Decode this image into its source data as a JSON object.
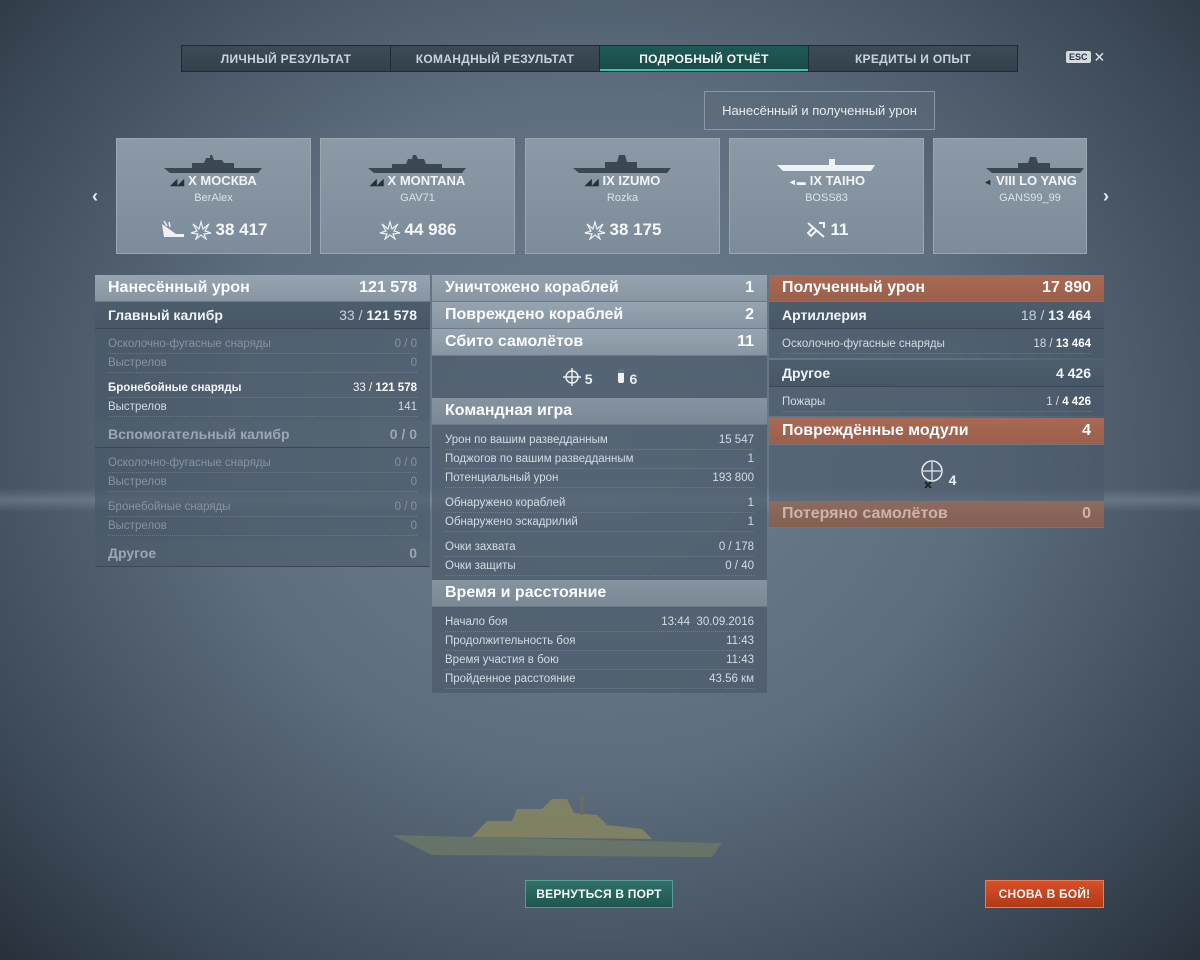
{
  "tabs": [
    {
      "label": "ЛИЧНЫЙ РЕЗУЛЬТАТ",
      "active": false
    },
    {
      "label": "КОМАНДНЫЙ РЕЗУЛЬТАТ",
      "active": false
    },
    {
      "label": "ПОДРОБНЫЙ ОТЧЁТ",
      "active": true
    },
    {
      "label": "КРЕДИТЫ И ОПЫТ",
      "active": false
    }
  ],
  "esc_label": "ESC",
  "damage_select": "Нанесённый и полученный урон",
  "ships": [
    {
      "tier_name": "X МОСКВА",
      "player": "BerAlex",
      "stat": "38 417",
      "icon": "torpedo-hit-icon"
    },
    {
      "tier_name": "X MONTANA",
      "player": "GAV71",
      "stat": "44 986",
      "icon": "damage-icon"
    },
    {
      "tier_name": "IX IZUMO",
      "player": "Rozka",
      "stat": "38 175",
      "icon": "damage-icon"
    },
    {
      "tier_name": "IX TAIHO",
      "player": "BOSS83",
      "stat": "11",
      "icon": "plane-shot-icon"
    },
    {
      "tier_name": "VIII LO YANG",
      "player": "GANS99_99",
      "stat": "",
      "icon": ""
    }
  ],
  "left": {
    "dealt": {
      "label": "Нанесённый урон",
      "value": "121 578"
    },
    "main": {
      "label": "Главный калибр",
      "hits": "33",
      "sep": "/",
      "value": "121 578"
    },
    "main_he": {
      "label": "Осколочно-фугасные снаряды",
      "value": "0 / 0"
    },
    "main_he_shots": {
      "label": "Выстрелов",
      "value": "0"
    },
    "main_ap": {
      "label": "Бронебойные снаряды",
      "hits": "33 /",
      "value": "121 578"
    },
    "main_ap_shots": {
      "label": "Выстрелов",
      "value": "141"
    },
    "secondary": {
      "label": "Вспомогательный калибр",
      "value": "0 / 0"
    },
    "sec_he": {
      "label": "Осколочно-фугасные снаряды",
      "value": "0 / 0"
    },
    "sec_he_shots": {
      "label": "Выстрелов",
      "value": "0"
    },
    "sec_ap": {
      "label": "Бронебойные снаряды",
      "value": "0 / 0"
    },
    "sec_ap_shots": {
      "label": "Выстрелов",
      "value": "0"
    },
    "other": {
      "label": "Другое",
      "value": "0"
    }
  },
  "middle": {
    "destroyed": {
      "label": "Уничтожено кораблей",
      "value": "1"
    },
    "damaged": {
      "label": "Повреждено кораблей",
      "value": "2"
    },
    "planes": {
      "label": "Сбито самолётов",
      "value": "11"
    },
    "planes_fighters": "5",
    "planes_bombers": "6",
    "team": {
      "title": "Командная игра",
      "spot_damage": {
        "label": "Урон по вашим разведданным",
        "value": "15 547"
      },
      "spot_fires": {
        "label": "Поджогов по вашим разведданным",
        "value": "1"
      },
      "potential": {
        "label": "Потенциальный урон",
        "value": "193 800"
      },
      "ships_spotted": {
        "label": "Обнаружено кораблей",
        "value": "1"
      },
      "squads_spotted": {
        "label": "Обнаружено эскадрилий",
        "value": "1"
      },
      "capture": {
        "label": "Очки захвата",
        "value": "0 / 178"
      },
      "defense": {
        "label": "Очки защиты",
        "value": "0 / 40"
      }
    },
    "time": {
      "title": "Время и расстояние",
      "start": {
        "label": "Начало боя",
        "value": "13:44  30.09.2016"
      },
      "duration": {
        "label": "Продолжительность боя",
        "value": "11:43"
      },
      "participation": {
        "label": "Время участия в бою",
        "value": "11:43"
      },
      "distance": {
        "label": "Пройденное расстояние",
        "value": "43.56 км"
      }
    }
  },
  "right": {
    "received": {
      "label": "Полученный урон",
      "value": "17 890"
    },
    "artillery": {
      "label": "Артиллерия",
      "hits": "18 /",
      "value": "13 464"
    },
    "art_he": {
      "label": "Осколочно-фугасные снаряды",
      "hits": "18 /",
      "value": "13 464"
    },
    "other": {
      "label": "Другое",
      "value": "4 426"
    },
    "fires": {
      "label": "Пожары",
      "hits": "1 /",
      "value": "4 426"
    },
    "modules": {
      "label": "Повреждённые модули",
      "value": "4"
    },
    "modules_count": "4",
    "planes_lost": {
      "label": "Потеряно самолётов",
      "value": "0"
    }
  },
  "buttons": {
    "port": "ВЕРНУТЬСЯ В ПОРТ",
    "battle": "СНОВА В БОЙ!"
  },
  "colors": {
    "accent_teal": "#1f5a55",
    "received_orange": "#a86a55",
    "battle_button": "#d8502a"
  }
}
